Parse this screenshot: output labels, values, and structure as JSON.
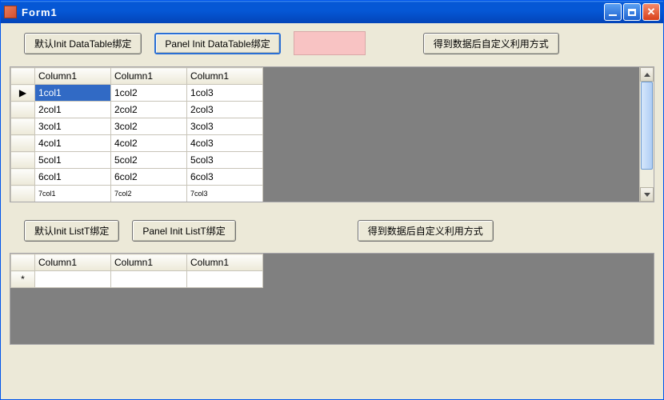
{
  "window": {
    "title": "Form1"
  },
  "buttons_top": {
    "btn1": "默认Init DataTable绑定",
    "btn2": "Panel Init DataTable绑定",
    "btn3": "得到数据后自定义利用方式"
  },
  "buttons_bottom": {
    "btn1": "默认Init ListT绑定",
    "btn2": "Panel Init ListT绑定",
    "btn3": "得到数据后自定义利用方式"
  },
  "grid1": {
    "columns": [
      "Column1",
      "Column1",
      "Column1"
    ],
    "rows": [
      {
        "marker": "▶",
        "cells": [
          "1col1",
          "1col2",
          "1col3"
        ],
        "selected": 0
      },
      {
        "marker": "",
        "cells": [
          "2col1",
          "2col2",
          "2col3"
        ]
      },
      {
        "marker": "",
        "cells": [
          "3col1",
          "3col2",
          "3col3"
        ]
      },
      {
        "marker": "",
        "cells": [
          "4col1",
          "4col2",
          "4col3"
        ]
      },
      {
        "marker": "",
        "cells": [
          "5col1",
          "5col2",
          "5col3"
        ]
      },
      {
        "marker": "",
        "cells": [
          "6col1",
          "6col2",
          "6col3"
        ]
      },
      {
        "marker": "",
        "cells": [
          "7col1",
          "7col2",
          "7col3"
        ]
      }
    ]
  },
  "grid2": {
    "columns": [
      "Column1",
      "Column1",
      "Column1"
    ],
    "rows": [
      {
        "marker": "*",
        "cells": [
          "",
          "",
          ""
        ]
      }
    ]
  }
}
